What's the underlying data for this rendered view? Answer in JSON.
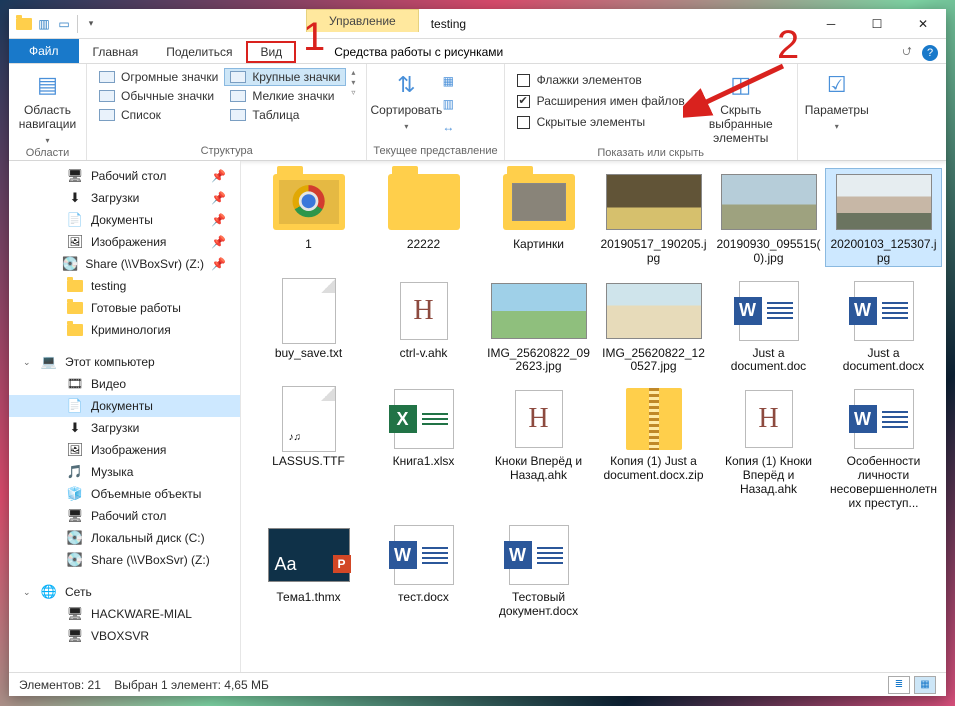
{
  "window": {
    "title": "testing"
  },
  "contextual_tab": "Управление",
  "contextual_sub": "Средства работы с рисунками",
  "tabs": {
    "file": "Файл",
    "home": "Главная",
    "share": "Поделиться",
    "view": "Вид"
  },
  "annotations": {
    "one": "1",
    "two": "2"
  },
  "ribbon": {
    "panes": {
      "nav_pane": "Область навигации",
      "nav_group": "Области",
      "layout_group": "Структура",
      "view_group": "Текущее представление",
      "show_group": "Показать или скрыть",
      "layout": {
        "huge": "Огромные значки",
        "large": "Крупные значки",
        "normal": "Обычные значки",
        "small": "Мелкие значки",
        "list": "Список",
        "table": "Таблица"
      },
      "sort": "Сортировать",
      "checks": {
        "item_checkboxes": "Флажки элементов",
        "file_ext": "Расширения имен файлов",
        "hidden": "Скрытые элементы"
      },
      "hide_selected": "Скрыть выбранные элементы",
      "options": "Параметры"
    }
  },
  "nav": [
    {
      "label": "Рабочий стол",
      "icon": "desktop",
      "pin": true
    },
    {
      "label": "Загрузки",
      "icon": "download",
      "pin": true
    },
    {
      "label": "Документы",
      "icon": "doc",
      "pin": true
    },
    {
      "label": "Изображения",
      "icon": "pic",
      "pin": true
    },
    {
      "label": "Share (\\\\VBoxSvr) (Z:)",
      "icon": "drive",
      "pin": true
    },
    {
      "label": "testing",
      "icon": "folder"
    },
    {
      "label": "Готовые работы",
      "icon": "folder"
    },
    {
      "label": "Криминология",
      "icon": "folder"
    }
  ],
  "nav_pc_label": "Этот компьютер",
  "nav_pc": [
    {
      "label": "Видео",
      "icon": "video"
    },
    {
      "label": "Документы",
      "icon": "doc",
      "sel": true
    },
    {
      "label": "Загрузки",
      "icon": "download"
    },
    {
      "label": "Изображения",
      "icon": "pic"
    },
    {
      "label": "Музыка",
      "icon": "music"
    },
    {
      "label": "Объемные объекты",
      "icon": "3d"
    },
    {
      "label": "Рабочий стол",
      "icon": "desktop"
    },
    {
      "label": "Локальный диск (C:)",
      "icon": "drive"
    },
    {
      "label": "Share (\\\\VBoxSvr) (Z:)",
      "icon": "drive"
    }
  ],
  "nav_net_label": "Сеть",
  "nav_net": [
    {
      "label": "HACKWARE-MIAL",
      "icon": "pcnet"
    },
    {
      "label": "VBOXSVR",
      "icon": "pcnet"
    }
  ],
  "files": [
    {
      "name": "1",
      "type": "folder-chrome"
    },
    {
      "name": "22222",
      "type": "folder"
    },
    {
      "name": "Картинки",
      "type": "folder-img"
    },
    {
      "name": "20190517_190205.jpg",
      "type": "img",
      "v": "t1"
    },
    {
      "name": "20190930_095515(0).jpg",
      "type": "img",
      "v": "t2"
    },
    {
      "name": "20200103_125307.jpg",
      "type": "img",
      "v": "t3",
      "sel": true
    },
    {
      "name": "buy_save.txt",
      "type": "txt"
    },
    {
      "name": "ctrl-v.ahk",
      "type": "ahk"
    },
    {
      "name": "IMG_25620822_092623.jpg",
      "type": "img",
      "v": "t5"
    },
    {
      "name": "IMG_25620822_120527.jpg",
      "type": "img",
      "v": "t6"
    },
    {
      "name": "Just a document.doc",
      "type": "word"
    },
    {
      "name": "Just a document.docx",
      "type": "word"
    },
    {
      "name": "LASSUS.TTF",
      "type": "ttf"
    },
    {
      "name": "Книга1.xlsx",
      "type": "excel"
    },
    {
      "name": "Кноки Вперёд и Назад.ahk",
      "type": "ahk"
    },
    {
      "name": "Копия (1) Just a document.docx.zip",
      "type": "zip"
    },
    {
      "name": "Копия (1) Кноки Вперёд и Назад.ahk",
      "type": "ahk"
    },
    {
      "name": "Особенности личности несовершеннолетних преступ...",
      "type": "word"
    },
    {
      "name": "Тема1.thmx",
      "type": "ppt"
    },
    {
      "name": "тест.docx",
      "type": "word"
    },
    {
      "name": "Тестовый документ.docx",
      "type": "word"
    }
  ],
  "status": {
    "left": "Элементов: 21",
    "selection": "Выбран 1 элемент: 4,65 МБ"
  }
}
